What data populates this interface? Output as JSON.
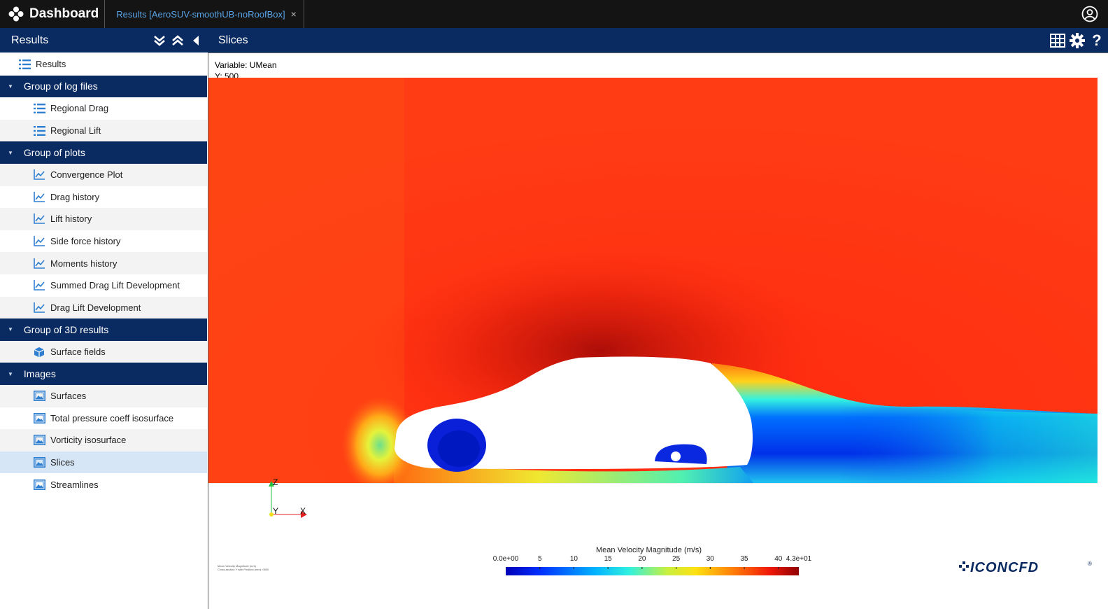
{
  "app": {
    "title": "Dashboard",
    "tab_label": "Results [AeroSUV-smoothUB-noRoofBox]",
    "tab_close": "×"
  },
  "left_panel": {
    "title": "Results",
    "root_item": "Results",
    "groups": [
      {
        "label": "Group of log files",
        "items": [
          "Regional Drag",
          "Regional Lift"
        ]
      },
      {
        "label": "Group of plots",
        "items": [
          "Convergence Plot",
          "Drag history",
          "Lift history",
          "Side force history",
          "Moments history",
          "Summed Drag Lift Development",
          "Drag Lift Development"
        ]
      },
      {
        "label": "Group of 3D results",
        "items": [
          "Surface fields"
        ]
      },
      {
        "label": "Images",
        "items": [
          "Surfaces",
          "Total pressure coeff isosurface",
          "Vorticity isosurface",
          "Slices",
          "Streamlines"
        ]
      }
    ],
    "selected_item": "Slices"
  },
  "viewer": {
    "title": "Slices",
    "variable_line": "Variable: UMean",
    "position_line": "Y: 500",
    "colorbar_title": "Mean Velocity Magnitude (m/s)",
    "colorbar_ticks": [
      "0.0e+00",
      "5",
      "10",
      "15",
      "20",
      "25",
      "30",
      "35",
      "40",
      "4.3e+01"
    ],
    "colorbar_min": 0,
    "colorbar_max": 43,
    "footnote_1": "Mean Velocity Magnitude (m/s)",
    "footnote_2": "Cross-section Y with Position (mm): 0500",
    "axis_z": "Z",
    "axis_y": "Y",
    "axis_x": "X",
    "logo_text": "ICONCFD",
    "logo_reg": "®"
  },
  "colors": {
    "header": "#0a2a62",
    "topbar": "#141414",
    "tab_link": "#5aa4e6",
    "selected_row": "#d6e6f7",
    "icon_blue": "#2f7fd0"
  },
  "icons": {
    "brand": "flower-dots-icon",
    "user": "user-circle-icon",
    "collapse_all": "double-chevron-down-icon",
    "expand_all": "double-chevron-up-icon",
    "hide_panel": "caret-left-icon",
    "table": "grid-table-icon",
    "settings": "gear-icon",
    "help": "question-icon"
  }
}
